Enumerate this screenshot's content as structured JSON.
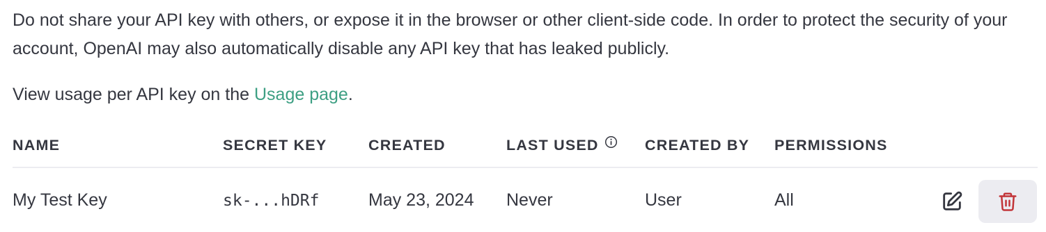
{
  "notice": {
    "warning": "Do not share your API key with others, or expose it in the browser or other client-side code. In order to protect the security of your account, OpenAI may also automatically disable any API key that has leaked publicly.",
    "usage_prefix": "View usage per API key on the ",
    "usage_link": "Usage page",
    "usage_suffix": "."
  },
  "table": {
    "columns": {
      "name": "NAME",
      "secret_key": "SECRET KEY",
      "created": "CREATED",
      "last_used": "LAST USED",
      "created_by": "CREATED BY",
      "permissions": "PERMISSIONS"
    },
    "rows": [
      {
        "name": "My Test Key",
        "secret_key": "sk-...hDRf",
        "created": "May 23, 2024",
        "last_used": "Never",
        "created_by": "User",
        "permissions": "All"
      }
    ]
  },
  "icons": {
    "last_used_info": "info-icon",
    "edit": "edit-icon",
    "delete": "trash-icon"
  },
  "colors": {
    "text": "#353740",
    "link": "#3d9f83",
    "delete_red": "#c23539",
    "delete_bg": "#ececf1",
    "divider": "#ececf1"
  }
}
